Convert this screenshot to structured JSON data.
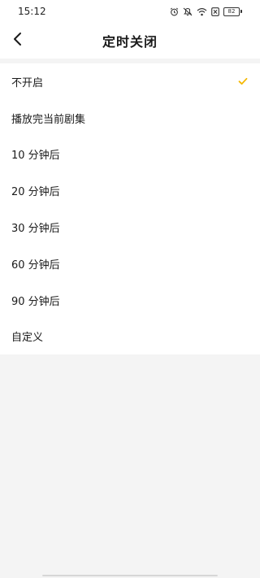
{
  "status_bar": {
    "time": "15:12",
    "battery": "82",
    "icons": [
      "alarm-icon",
      "mute-icon",
      "wifi-icon",
      "sim-off-icon",
      "battery-icon"
    ]
  },
  "header": {
    "title": "定时关闭",
    "back_icon": "chevron-left-icon"
  },
  "options": [
    {
      "label": "不开启",
      "selected": true
    },
    {
      "label": "播放完当前剧集",
      "selected": false
    },
    {
      "label": "10 分钟后",
      "selected": false
    },
    {
      "label": "20 分钟后",
      "selected": false
    },
    {
      "label": "30 分钟后",
      "selected": false
    },
    {
      "label": "60 分钟后",
      "selected": false
    },
    {
      "label": "90 分钟后",
      "selected": false
    },
    {
      "label": "自定义",
      "selected": false
    }
  ],
  "colors": {
    "accent_check": "#f5b800",
    "background": "#f4f4f4",
    "surface": "#ffffff"
  }
}
